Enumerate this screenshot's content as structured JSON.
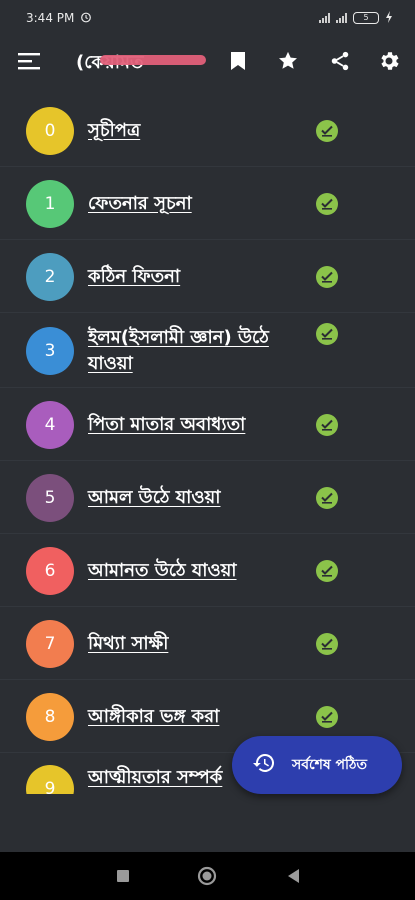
{
  "status_bar": {
    "time": "3:44 PM",
    "battery": "5"
  },
  "app_bar": {
    "title": "(কেয়ামত"
  },
  "chapters": [
    {
      "number": "0",
      "title": "সূচীপত্র",
      "color": "#e6c52a"
    },
    {
      "number": "1",
      "title": "ফেতনার সূচনা",
      "color": "#57c877"
    },
    {
      "number": "2",
      "title": "কঠিন ফিতনা",
      "color": "#4d9dbf"
    },
    {
      "number": "3",
      "title": "ইলম(ইসলামী জ্ঞান) উঠে যাওয়া",
      "color": "#3a8ed6"
    },
    {
      "number": "4",
      "title": "পিতা মাতার অবাধ্যতা",
      "color": "#a95dbd"
    },
    {
      "number": "5",
      "title": "আমল উঠে যাওয়া",
      "color": "#7b4f7c"
    },
    {
      "number": "6",
      "title": "আমানত উঠে যাওয়া",
      "color": "#f06060"
    },
    {
      "number": "7",
      "title": "মিথ্যা সাক্ষী",
      "color": "#f27d4f"
    },
    {
      "number": "8",
      "title": "আঙ্গীকার ভঙ্গ করা",
      "color": "#f59c3b"
    },
    {
      "number": "9",
      "title": "আত্মীয়তার সম্পর্ক",
      "color": "#e6c52a"
    }
  ],
  "fab": {
    "label": "সর্বশেষ পঠিত"
  },
  "colors": {
    "background": "#2b2e33",
    "check": "#8bc34a",
    "fab": "#2d3eae"
  }
}
